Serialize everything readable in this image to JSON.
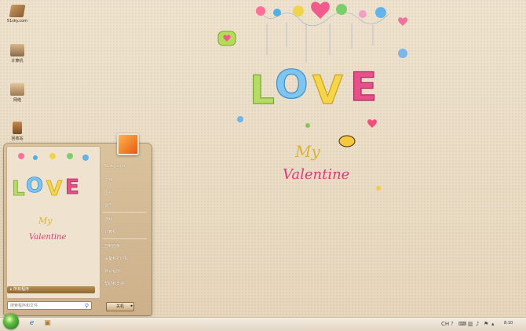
{
  "desktop": {
    "icons": [
      {
        "label": "51sky.com"
      },
      {
        "label": "计算机"
      },
      {
        "label": "网络"
      },
      {
        "label": "回收站"
      }
    ]
  },
  "wallpaper": {
    "love": [
      "L",
      "O",
      "V",
      "E"
    ],
    "my": "My",
    "valentine": "Valentine"
  },
  "start_menu": {
    "right_items": [
      "51sky.com",
      "文档",
      "图片",
      "音乐",
      "游戏",
      "计算机",
      "控制面板",
      "设备和打印机",
      "默认程序",
      "帮助和支持"
    ],
    "all_programs": "所有程序",
    "search_placeholder": "搜索程序和文件",
    "shutdown_label": "关机"
  },
  "taskbar": {
    "clock": "8:10",
    "tray_ch": "CH"
  },
  "colors": {
    "accent": "#8f6a33",
    "orb": "#5fbf3c"
  }
}
